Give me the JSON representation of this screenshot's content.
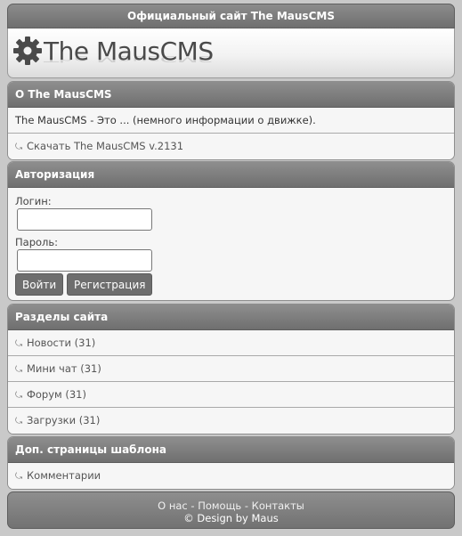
{
  "site": {
    "title": "Официальный сайт The MausCMS",
    "logo_text": "The MausCMS"
  },
  "about": {
    "title": "О The MausCMS",
    "text": "The MausCMS - Это ... (немного информации о движке).",
    "download": "Скачать The MausCMS v.2131"
  },
  "auth": {
    "title": "Авторизация",
    "login_label": "Логин:",
    "password_label": "Пароль:",
    "login_button": "Войти",
    "register_button": "Регистрация"
  },
  "sections": {
    "title": "Разделы сайта",
    "items": [
      {
        "label": "Новости (31)"
      },
      {
        "label": "Мини чат (31)"
      },
      {
        "label": "Форум (31)"
      },
      {
        "label": "Загрузки (31)"
      }
    ]
  },
  "extra": {
    "title": "Доп. страницы шаблона",
    "items": [
      {
        "label": "Комментарии"
      }
    ]
  },
  "footer": {
    "link_about": "О нас",
    "sep1": " - ",
    "link_help": "Помощь",
    "sep2": " - ",
    "link_contacts": "Контакты",
    "copyright": "© Design by Maus"
  },
  "icons": {
    "logo": "gear-icon",
    "list_arrow": "arrow-icon"
  }
}
